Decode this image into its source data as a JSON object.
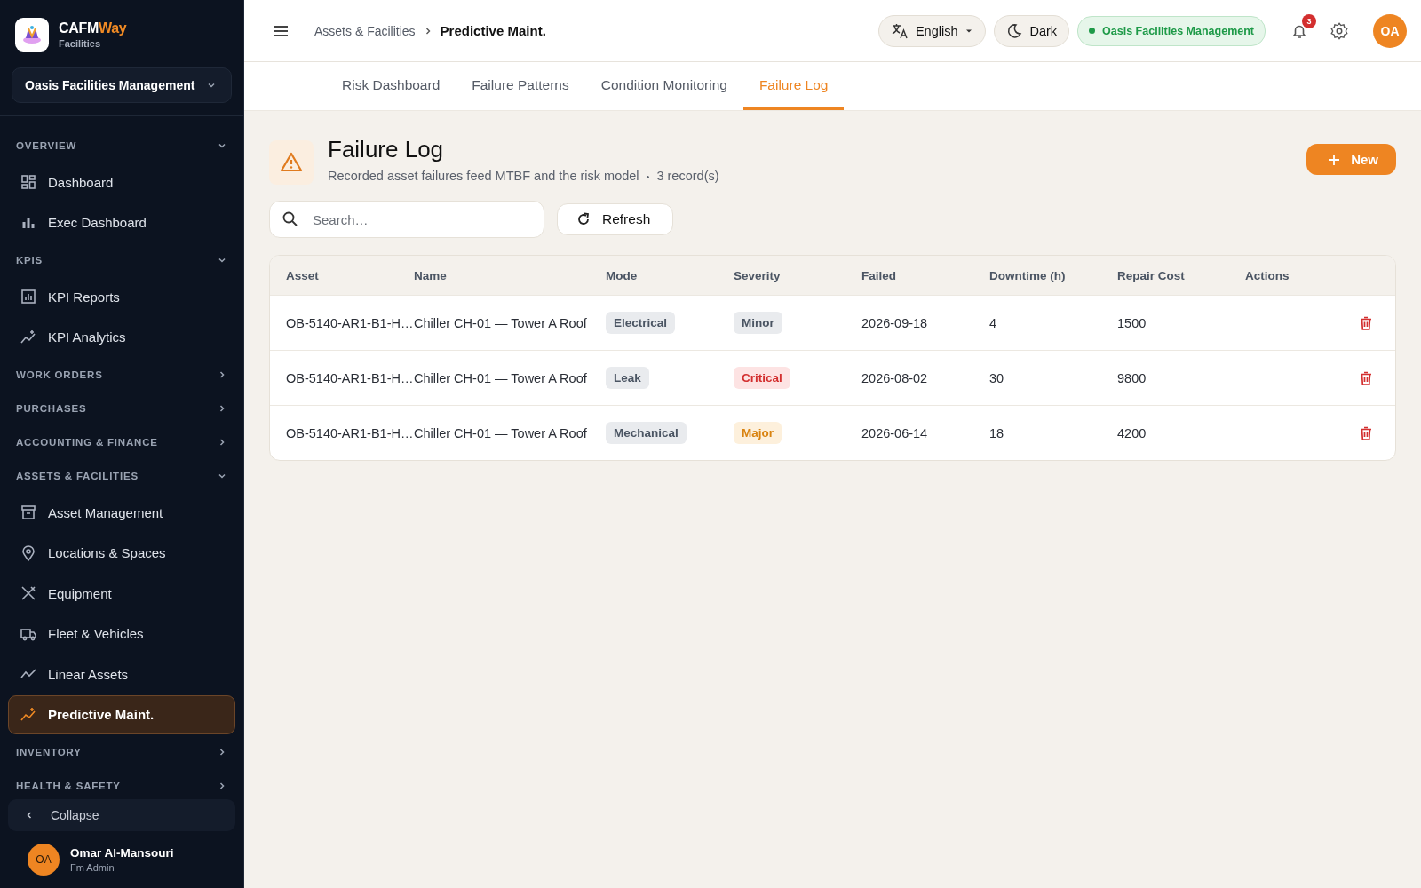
{
  "brand": {
    "name_main": "CAFM",
    "name_accent": "Way",
    "subtitle": "Facilities"
  },
  "org_selector": {
    "value": "Oasis Facilities Management"
  },
  "sidebar": {
    "sections": [
      {
        "label": "OVERVIEW",
        "expanded": true,
        "items": [
          {
            "label": "Dashboard",
            "selected": false
          },
          {
            "label": "Exec Dashboard",
            "selected": false
          }
        ]
      },
      {
        "label": "KPIS",
        "expanded": true,
        "items": [
          {
            "label": "KPI Reports",
            "selected": false
          },
          {
            "label": "KPI Analytics",
            "selected": false
          }
        ]
      },
      {
        "label": "WORK ORDERS",
        "expanded": false
      },
      {
        "label": "PURCHASES",
        "expanded": false
      },
      {
        "label": "ACCOUNTING & FINANCE",
        "expanded": false
      },
      {
        "label": "ASSETS & FACILITIES",
        "expanded": true,
        "items": [
          {
            "label": "Asset Management",
            "selected": false
          },
          {
            "label": "Locations & Spaces",
            "selected": false
          },
          {
            "label": "Equipment",
            "selected": false
          },
          {
            "label": "Fleet & Vehicles",
            "selected": false
          },
          {
            "label": "Linear Assets",
            "selected": false
          },
          {
            "label": "Predictive Maint.",
            "selected": true
          }
        ]
      },
      {
        "label": "INVENTORY",
        "expanded": false
      },
      {
        "label": "HEALTH & SAFETY",
        "expanded": false
      }
    ],
    "collapse": "Collapse",
    "user": {
      "initials": "OA",
      "name": "Omar Al-Mansouri",
      "role": "Fm Admin"
    }
  },
  "breadcrumb": [
    "Assets & Facilities",
    "Predictive Maint."
  ],
  "topbar": {
    "language": "English",
    "theme": "Dark",
    "org_badge": "Oasis Facilities Management",
    "notifications": "3",
    "avatar": "OA"
  },
  "tabs": [
    {
      "label": "Risk Dashboard",
      "selected": false
    },
    {
      "label": "Failure Patterns",
      "selected": false
    },
    {
      "label": "Condition Monitoring",
      "selected": false
    },
    {
      "label": "Failure Log",
      "selected": true
    }
  ],
  "page": {
    "title": "Failure Log",
    "subtitle": "Recorded asset failures feed MTBF and the risk model",
    "separator": "•",
    "count": "3 record(s)",
    "new_button": "New",
    "search": {
      "placeholder": "Search…"
    },
    "refresh_button": "Refresh"
  },
  "table": {
    "columns": [
      "Asset",
      "Name",
      "Mode",
      "Severity",
      "Failed",
      "Downtime (h)",
      "Repair Cost",
      "Actions"
    ],
    "rows": [
      {
        "asset": "OB-5140-AR1-B1-H…",
        "name": "Chiller CH-01 — Tower A Roof",
        "mode": "Electrical",
        "severity": "Minor",
        "kind": "minor",
        "failed": "2026-09-18",
        "downtime": "4",
        "cost": "1500"
      },
      {
        "asset": "OB-5140-AR1-B1-H…",
        "name": "Chiller CH-01 — Tower A Roof",
        "mode": "Leak",
        "severity": "Critical",
        "kind": "critical",
        "failed": "2026-08-02",
        "downtime": "30",
        "cost": "9800"
      },
      {
        "asset": "OB-5140-AR1-B1-H…",
        "name": "Chiller CH-01 — Tower A Roof",
        "mode": "Mechanical",
        "severity": "Major",
        "kind": "major",
        "failed": "2026-06-14",
        "downtime": "18",
        "cost": "4200"
      }
    ]
  }
}
